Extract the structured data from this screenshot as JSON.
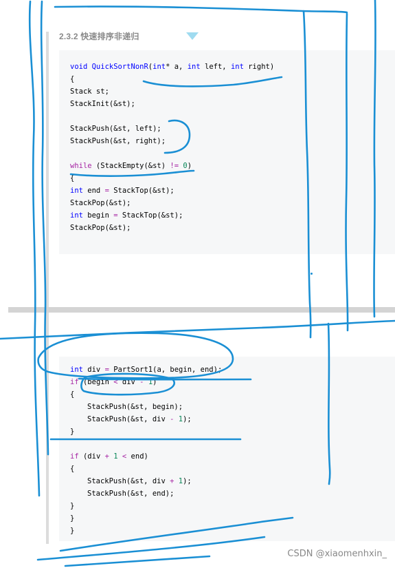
{
  "section": {
    "heading": "2.3.2 快速排序非递归"
  },
  "code_top": [
    {
      "segments": [
        {
          "t": "void ",
          "c": "kw"
        },
        {
          "t": "QuickSortNonR",
          "c": "fn"
        },
        {
          "t": "(",
          "c": "pl"
        },
        {
          "t": "int",
          "c": "kw"
        },
        {
          "t": "* a, ",
          "c": "pl"
        },
        {
          "t": "int",
          "c": "kw"
        },
        {
          "t": " left, ",
          "c": "pl"
        },
        {
          "t": "int",
          "c": "kw"
        },
        {
          "t": " right)",
          "c": "pl"
        }
      ]
    },
    {
      "segments": [
        {
          "t": "{",
          "c": "pl"
        }
      ]
    },
    {
      "segments": [
        {
          "t": "Stack st;",
          "c": "pl"
        }
      ]
    },
    {
      "segments": [
        {
          "t": "StackInit(&st);",
          "c": "pl"
        }
      ]
    },
    {
      "segments": []
    },
    {
      "segments": [
        {
          "t": "StackPush(&st, left);",
          "c": "pl"
        }
      ]
    },
    {
      "segments": [
        {
          "t": "StackPush(&st, right);",
          "c": "pl"
        }
      ]
    },
    {
      "segments": []
    },
    {
      "segments": [
        {
          "t": "while",
          "c": "ctl"
        },
        {
          "t": " (StackEmpty(&st) ",
          "c": "pl"
        },
        {
          "t": "!=",
          "c": "op"
        },
        {
          "t": " ",
          "c": "pl"
        },
        {
          "t": "0",
          "c": "num"
        },
        {
          "t": ")",
          "c": "pl"
        }
      ]
    },
    {
      "segments": [
        {
          "t": "{",
          "c": "pl"
        }
      ]
    },
    {
      "segments": [
        {
          "t": "int",
          "c": "kw"
        },
        {
          "t": " end ",
          "c": "pl"
        },
        {
          "t": "=",
          "c": "op"
        },
        {
          "t": " StackTop(&st);",
          "c": "pl"
        }
      ]
    },
    {
      "segments": [
        {
          "t": "StackPop(&st);",
          "c": "pl"
        }
      ]
    },
    {
      "segments": [
        {
          "t": "int",
          "c": "kw"
        },
        {
          "t": " begin ",
          "c": "pl"
        },
        {
          "t": "=",
          "c": "op"
        },
        {
          "t": " StackTop(&st);",
          "c": "pl"
        }
      ]
    },
    {
      "segments": [
        {
          "t": "StackPop(&st);",
          "c": "pl"
        }
      ]
    }
  ],
  "code_bottom": [
    {
      "indent": false,
      "segments": [
        {
          "t": "int",
          "c": "kw"
        },
        {
          "t": " div ",
          "c": "pl"
        },
        {
          "t": "=",
          "c": "op"
        },
        {
          "t": " PartSort1(a, begin, end);",
          "c": "pl"
        }
      ]
    },
    {
      "indent": false,
      "segments": [
        {
          "t": "if",
          "c": "ctl"
        },
        {
          "t": " (begin ",
          "c": "pl"
        },
        {
          "t": "<",
          "c": "op"
        },
        {
          "t": " div ",
          "c": "pl"
        },
        {
          "t": "-",
          "c": "op"
        },
        {
          "t": " ",
          "c": "pl"
        },
        {
          "t": "1",
          "c": "num"
        },
        {
          "t": ")",
          "c": "pl"
        }
      ]
    },
    {
      "indent": false,
      "segments": [
        {
          "t": "{",
          "c": "pl"
        }
      ]
    },
    {
      "indent": true,
      "segments": [
        {
          "t": "StackPush(&st, begin);",
          "c": "pl"
        }
      ]
    },
    {
      "indent": true,
      "segments": [
        {
          "t": "StackPush(&st, div ",
          "c": "pl"
        },
        {
          "t": "-",
          "c": "op"
        },
        {
          "t": " ",
          "c": "pl"
        },
        {
          "t": "1",
          "c": "num"
        },
        {
          "t": ");",
          "c": "pl"
        }
      ]
    },
    {
      "indent": false,
      "segments": [
        {
          "t": "}",
          "c": "pl"
        }
      ]
    },
    {
      "indent": false,
      "segments": []
    },
    {
      "indent": false,
      "segments": [
        {
          "t": "if",
          "c": "ctl"
        },
        {
          "t": " (div ",
          "c": "pl"
        },
        {
          "t": "+",
          "c": "op"
        },
        {
          "t": " ",
          "c": "pl"
        },
        {
          "t": "1",
          "c": "num"
        },
        {
          "t": " ",
          "c": "pl"
        },
        {
          "t": "<",
          "c": "op"
        },
        {
          "t": " end)",
          "c": "pl"
        }
      ]
    },
    {
      "indent": false,
      "segments": [
        {
          "t": "{",
          "c": "pl"
        }
      ]
    },
    {
      "indent": true,
      "segments": [
        {
          "t": "StackPush(&st, div ",
          "c": "pl"
        },
        {
          "t": "+",
          "c": "op"
        },
        {
          "t": " ",
          "c": "pl"
        },
        {
          "t": "1",
          "c": "num"
        },
        {
          "t": ");",
          "c": "pl"
        }
      ]
    },
    {
      "indent": true,
      "segments": [
        {
          "t": "StackPush(&st, end);",
          "c": "pl"
        }
      ]
    },
    {
      "indent": false,
      "segments": [
        {
          "t": "}",
          "c": "pl"
        }
      ]
    },
    {
      "indent": false,
      "segments": [
        {
          "t": "}",
          "c": "pl"
        }
      ]
    },
    {
      "indent": false,
      "segments": [
        {
          "t": "}",
          "c": "pl"
        }
      ]
    }
  ],
  "watermark": {
    "text": "CSDN @xiaomenhxin_"
  },
  "colors": {
    "ink": "#1a8fd4",
    "keyword": "#0000ff",
    "control": "#a626a4",
    "number": "#098658",
    "code_background": "#f6f7f8"
  }
}
